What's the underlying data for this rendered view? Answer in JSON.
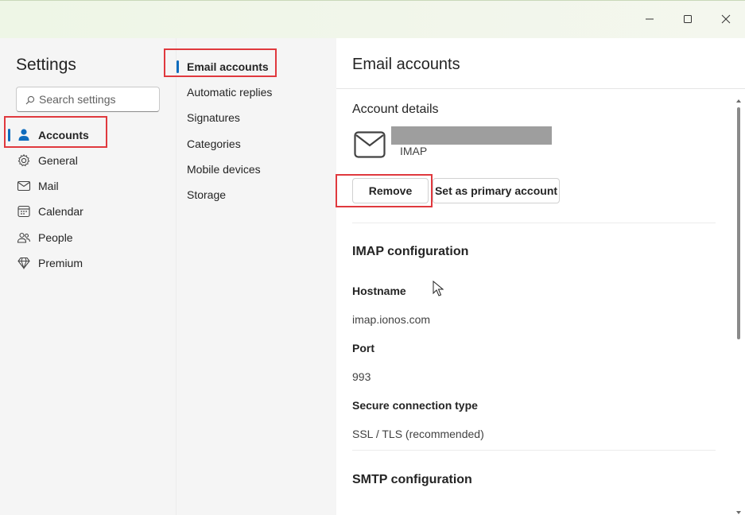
{
  "window": {
    "minimize_icon": "minimize-icon",
    "maximize_icon": "maximize-icon",
    "close_icon": "close-icon"
  },
  "settings": {
    "title": "Settings",
    "search_placeholder": "Search settings",
    "nav": [
      {
        "label": "Accounts",
        "icon": "person-icon",
        "active": true
      },
      {
        "label": "General",
        "icon": "gear-icon"
      },
      {
        "label": "Mail",
        "icon": "mail-icon"
      },
      {
        "label": "Calendar",
        "icon": "calendar-icon"
      },
      {
        "label": "People",
        "icon": "people-icon"
      },
      {
        "label": "Premium",
        "icon": "diamond-icon"
      }
    ]
  },
  "accounts_menu": {
    "items": [
      {
        "label": "Email accounts",
        "active": true
      },
      {
        "label": "Automatic replies"
      },
      {
        "label": "Signatures"
      },
      {
        "label": "Categories"
      },
      {
        "label": "Mobile devices"
      },
      {
        "label": "Storage"
      }
    ]
  },
  "panel": {
    "title": "Email accounts",
    "account_details_heading": "Account details",
    "account_type": "IMAP",
    "remove_label": "Remove",
    "set_primary_label": "Set as primary account",
    "imap_heading": "IMAP configuration",
    "hostname_label": "Hostname",
    "hostname_value": "imap.ionos.com",
    "port_label": "Port",
    "port_value": "993",
    "secure_label": "Secure connection type",
    "secure_value": "SSL / TLS (recommended)",
    "smtp_heading": "SMTP configuration"
  },
  "colors": {
    "accent": "#0f6cbd",
    "highlight_box": "#e0393e"
  }
}
